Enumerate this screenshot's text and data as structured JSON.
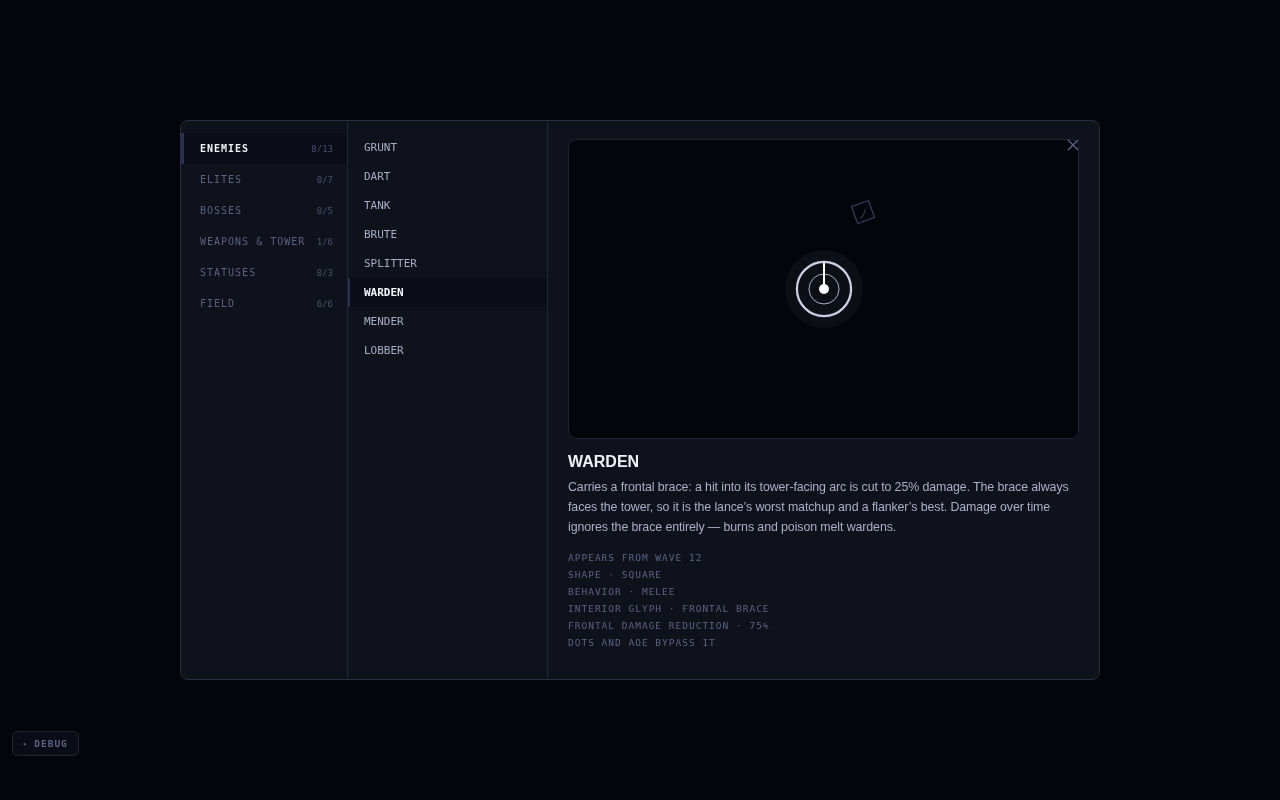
{
  "categories": [
    {
      "label": "ENEMIES",
      "count": "8/13",
      "selected": true
    },
    {
      "label": "ELITES",
      "count": "0/7",
      "selected": false
    },
    {
      "label": "BOSSES",
      "count": "0/5",
      "selected": false
    },
    {
      "label": "WEAPONS & TOWER",
      "count": "1/6",
      "selected": false
    },
    {
      "label": "STATUSES",
      "count": "0/3",
      "selected": false
    },
    {
      "label": "FIELD",
      "count": "6/6",
      "selected": false
    }
  ],
  "entries": [
    {
      "label": "GRUNT",
      "selected": false
    },
    {
      "label": "DART",
      "selected": false
    },
    {
      "label": "TANK",
      "selected": false
    },
    {
      "label": "BRUTE",
      "selected": false
    },
    {
      "label": "SPLITTER",
      "selected": false
    },
    {
      "label": "WARDEN",
      "selected": true
    },
    {
      "label": "MENDER",
      "selected": false
    },
    {
      "label": "LOBBER",
      "selected": false
    }
  ],
  "detail": {
    "title": "WARDEN",
    "description": "Carries a frontal brace: a hit into its tower-facing arc is cut to 25% damage. The brace always faces the tower, so it is the lance’s worst matchup and a flanker’s best. Damage over time ignores the brace entirely — burns and poison melt wardens.",
    "facts": [
      "APPEARS FROM WAVE 12",
      "SHAPE · SQUARE",
      "BEHAVIOR · MELEE",
      "INTERIOR GLYPH · FRONTAL BRACE",
      "FRONTAL DAMAGE REDUCTION · 75%",
      "DOTS AND AOE BYPASS IT"
    ]
  },
  "debug_button": {
    "icon": "▸",
    "label": "DEBUG"
  }
}
